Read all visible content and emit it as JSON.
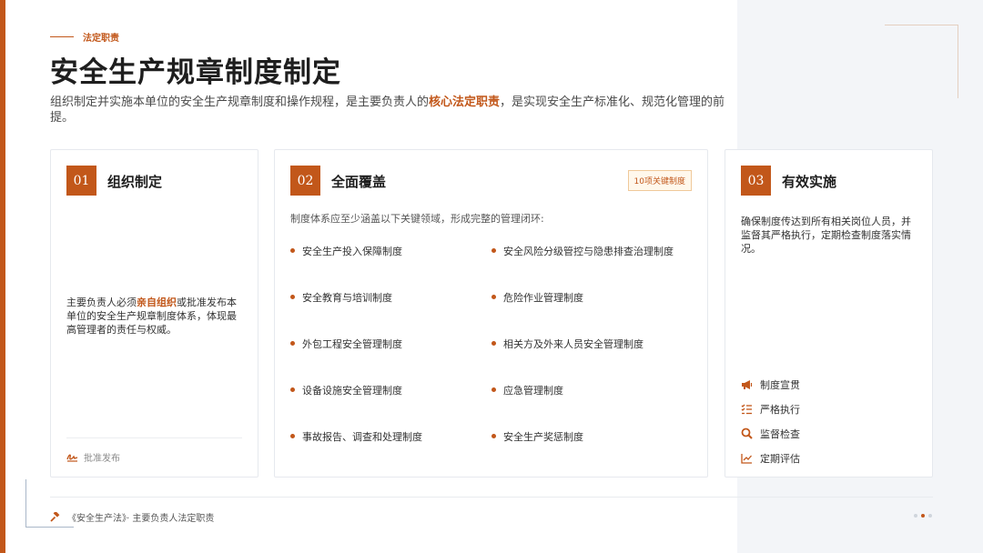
{
  "header": {
    "eyebrow": "法定职责",
    "title": "安全生产规章制度制定",
    "subtitle_pre": "组织制定并实施本单位的安全生产规章制度和操作规程，是主要负责人的",
    "subtitle_hl": "核心法定职责",
    "subtitle_post": "，是实现安全生产标准化、规范化管理的前提。"
  },
  "cards": {
    "c1": {
      "num": "01",
      "title": "组织制定",
      "desc_pre": "主要负责人必须",
      "desc_hl": "亲自组织",
      "desc_post": "或批准发布本单位的安全生产规章制度体系，体现最高管理者的责任与权威。",
      "footer": "批准发布",
      "footer_icon": "signature-icon"
    },
    "c2": {
      "num": "02",
      "title": "全面覆盖",
      "badge": "10项关键制度",
      "intro": "制度体系应至少涵盖以下关键领域，形成完整的管理闭环:",
      "rules": [
        "安全生产投入保障制度",
        "安全风险分级管控与隐患排查治理制度",
        "安全教育与培训制度",
        "危险作业管理制度",
        "外包工程安全管理制度",
        "相关方及外来人员安全管理制度",
        "设备设施安全管理制度",
        "应急管理制度",
        "事故报告、调查和处理制度",
        "安全生产奖惩制度"
      ]
    },
    "c3": {
      "num": "03",
      "title": "有效实施",
      "desc": "确保制度传达到所有相关岗位人员，并监督其严格执行，定期检查制度落实情况。",
      "actions": [
        {
          "label": "制度宣贯",
          "icon": "megaphone-icon"
        },
        {
          "label": "严格执行",
          "icon": "checklist-icon"
        },
        {
          "label": "监督检查",
          "icon": "search-icon"
        },
        {
          "label": "定期评估",
          "icon": "line-chart-icon"
        }
      ]
    }
  },
  "footer": {
    "text": "《安全生产法》· 主要负责人法定职责",
    "icon": "gavel-icon"
  },
  "colors": {
    "accent": "#c2571a",
    "panel": "#f3f5f8"
  }
}
